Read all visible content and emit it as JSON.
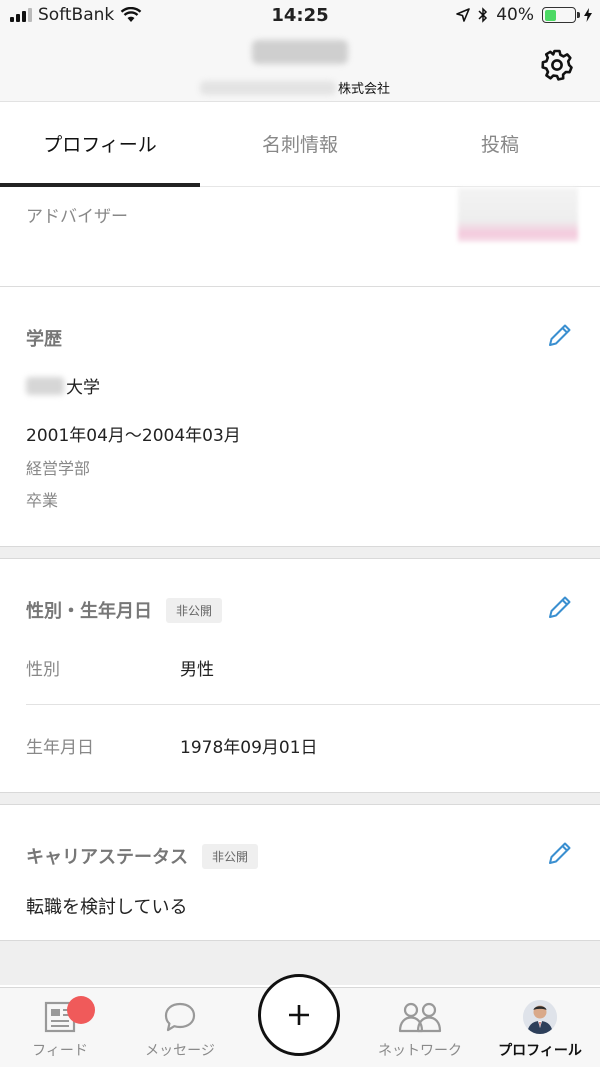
{
  "status_bar": {
    "carrier": "SoftBank",
    "time": "14:25",
    "battery": "40%",
    "battery_level": 0.4
  },
  "header": {
    "company_suffix": "株式会社"
  },
  "tabs": [
    {
      "label": "プロフィール",
      "active": true
    },
    {
      "label": "名刺情報",
      "active": false
    },
    {
      "label": "投稿",
      "active": false
    }
  ],
  "advisor": {
    "label": "アドバイザー"
  },
  "education": {
    "title": "学歴",
    "school_suffix": "大学",
    "period": "2001年04月〜2004年03月",
    "faculty": "経営学部",
    "status": "卒業"
  },
  "personal": {
    "title": "性別・生年月日",
    "badge": "非公開",
    "gender_label": "性別",
    "gender_value": "男性",
    "birthday_label": "生年月日",
    "birthday_value": "1978年09月01日"
  },
  "career": {
    "title": "キャリアステータス",
    "badge": "非公開",
    "value": "転職を検討している"
  },
  "tabbar": {
    "feed": "フィード",
    "messages": "メッセージ",
    "network": "ネットワーク",
    "profile": "プロフィール"
  },
  "colors": {
    "accent_blue": "#3a8fd0",
    "notification": "#f05a5a",
    "battery_green": "#4cd964"
  }
}
